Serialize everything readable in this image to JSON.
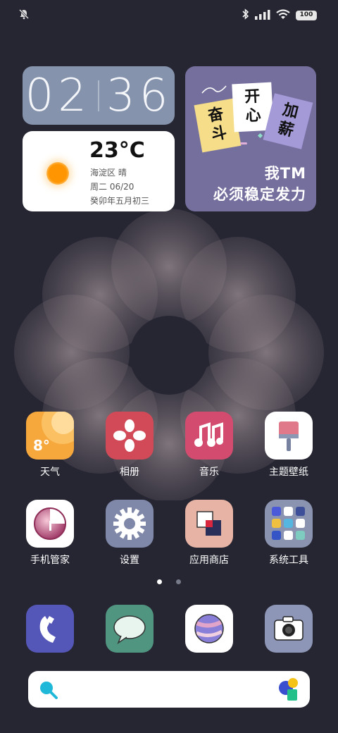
{
  "status_bar": {
    "battery": "100"
  },
  "clock": {
    "hours": "02",
    "minutes": "36"
  },
  "weather": {
    "temperature": "23°C",
    "location_condition": "海淀区 晴",
    "date": "周二 06/20",
    "lunar_date": "癸卯年五月初三"
  },
  "poster": {
    "card_1": "奋斗",
    "card_2": "开心",
    "card_3": "加薪",
    "line_1": "我TM",
    "line_2": "必须稳定发力"
  },
  "apps_row_1": [
    {
      "label": "天气",
      "icon": "weather-icon",
      "badge": "8°"
    },
    {
      "label": "相册",
      "icon": "gallery-icon"
    },
    {
      "label": "音乐",
      "icon": "music-icon"
    },
    {
      "label": "主题壁纸",
      "icon": "theme-icon"
    }
  ],
  "apps_row_2": [
    {
      "label": "手机管家",
      "icon": "security-icon"
    },
    {
      "label": "设置",
      "icon": "settings-gear-icon"
    },
    {
      "label": "应用商店",
      "icon": "app-store-icon"
    },
    {
      "label": "系统工具",
      "icon": "folder-icon"
    }
  ],
  "dock": [
    {
      "icon": "phone-icon"
    },
    {
      "icon": "messages-icon"
    },
    {
      "icon": "browser-icon"
    },
    {
      "icon": "camera-icon"
    }
  ],
  "page_indicator": {
    "pages": 2,
    "current": 1
  },
  "search_bar": {
    "left_icon": "search-icon",
    "right_icon": "assistant-icon"
  }
}
